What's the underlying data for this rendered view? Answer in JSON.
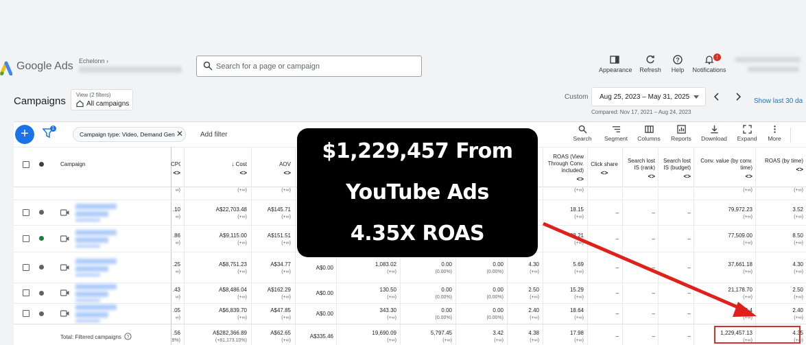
{
  "header": {
    "app_name": "Google Ads",
    "account_label": "Echelonn",
    "search_placeholder": "Search for a page or campaign",
    "tools": [
      {
        "label": "Appearance",
        "icon": "appearance-icon"
      },
      {
        "label": "Refresh",
        "icon": "refresh-icon"
      },
      {
        "label": "Help",
        "icon": "help-icon"
      },
      {
        "label": "Notifications",
        "icon": "bell-icon",
        "badge": "!"
      }
    ]
  },
  "subheader": {
    "title": "Campaigns",
    "view_line1": "View (2 filters)",
    "view_line2": "All campaigns",
    "custom_label": "Custom",
    "date_range": "Aug 25, 2023 – May 31, 2025",
    "compared": "Compared: Nov 17, 2021 – Aug 24, 2023",
    "show_last": "Show last 30 da"
  },
  "filterbar": {
    "filter_count": "1",
    "chip_label": "Campaign type: Video, Demand Gen",
    "add_filter": "Add filter",
    "tools": [
      "Search",
      "Segment",
      "Columns",
      "Reports",
      "Download",
      "Expand",
      "More"
    ]
  },
  "table": {
    "headers": {
      "campaign": "Campaign",
      "cpc": "CPC",
      "cost": "Cost",
      "aov": "AOV",
      "roas_vt": "ROAS (View Through Conv. included)",
      "click_share": "Click share",
      "lost_rank": "Search lost IS (rank)",
      "lost_budget": "Search lost IS (budget)",
      "conv_value": "Conv. value (by conv. time)",
      "roas": "ROAS (by time)"
    },
    "rows": [
      {
        "status": "grey",
        "cpc": "",
        "cpc_sub": "∞)",
        "cost": "",
        "cost_sub": "(+∞)",
        "aov": "",
        "aov_sub": "(+∞)",
        "c5": "",
        "c5s": "",
        "c6": "",
        "c6s": "",
        "c7": "",
        "c7s": "",
        "c8": "",
        "c8s": "",
        "roas_vt": "",
        "roas_vt_sub": "(+∞)",
        "click_share": "",
        "lost_rank": "",
        "lost_budget": "",
        "conv_value": "",
        "conv_value_sub": "(+∞)",
        "roas": "",
        "roas_sub": "(+∞)"
      },
      {
        "status": "grey",
        "cpc": ".10",
        "cpc_sub": "∞)",
        "cost": "A$22,703.48",
        "cost_sub": "(+∞)",
        "aov": "A$145.71",
        "aov_sub": "(+∞)",
        "c5": "",
        "c5s": "",
        "c6": "",
        "c6s": "",
        "c7": "",
        "c7s": "",
        "c8": "",
        "c8s": "",
        "roas_vt": "18.15",
        "roas_vt_sub": "(+∞)",
        "click_share": "–",
        "lost_rank": "–",
        "lost_budget": "–",
        "conv_value": "79,972.23",
        "conv_value_sub": "(+∞)",
        "roas": "3.52",
        "roas_sub": "(+∞)"
      },
      {
        "status": "green",
        "cpc": ".86",
        "cpc_sub": "∞)",
        "cost": "A$9,115.00",
        "cost_sub": "(+∞)",
        "aov": "A$151.51",
        "aov_sub": "(+∞)",
        "c5": "",
        "c5s": "",
        "c6": "",
        "c6s": "",
        "c7": "",
        "c7s": "",
        "c8": "",
        "c8s": "",
        "roas_vt": "28.21",
        "roas_vt_sub": "(+∞)",
        "click_share": "–",
        "lost_rank": "–",
        "lost_budget": "–",
        "conv_value": "77,509.00",
        "conv_value_sub": "(+∞)",
        "roas": "8.50",
        "roas_sub": "(+∞)"
      },
      {
        "status": "grey",
        "cpc": ".25",
        "cpc_sub": "∞)",
        "cost": "A$8,751.23",
        "cost_sub": "(+∞)",
        "aov": "A$34.77",
        "aov_sub": "(+∞)",
        "c5": "A$0.00",
        "c5s": "",
        "c6": "1,083.02",
        "c6s": "(+∞)",
        "c7": "0.00",
        "c7s": "(0.00%)",
        "c8": "0.00",
        "c8s": "(0.00%)",
        "c9": "4.30",
        "c9s": "(+∞)",
        "roas_vt": "5.69",
        "roas_vt_sub": "(+∞)",
        "click_share": "–",
        "lost_rank": "–",
        "lost_budget": "–",
        "conv_value": "37,661.18",
        "conv_value_sub": "(+∞)",
        "roas": "4.30",
        "roas_sub": "(+∞)"
      },
      {
        "status": "grey",
        "cpc": ".43",
        "cpc_sub": "∞)",
        "cost": "A$8,486.04",
        "cost_sub": "(+∞)",
        "aov": "A$162.29",
        "aov_sub": "(+∞)",
        "c5": "A$0.00",
        "c5s": "",
        "c6": "130.50",
        "c6s": "(+∞)",
        "c7": "0.00",
        "c7s": "(0.00%)",
        "c8": "0.00",
        "c8s": "(0.00%)",
        "c9": "2.50",
        "c9s": "(+∞)",
        "roas_vt": "15.29",
        "roas_vt_sub": "(+∞)",
        "click_share": "–",
        "lost_rank": "–",
        "lost_budget": "–",
        "conv_value": "21,178.70",
        "conv_value_sub": "(+∞)",
        "roas": "2.50",
        "roas_sub": "(+∞)"
      },
      {
        "status": "grey",
        "cpc": ".05",
        "cpc_sub": "∞)",
        "cost": "A$6,839.70",
        "cost_sub": "(+∞)",
        "aov": "A$47.85",
        "aov_sub": "(+∞)",
        "c5": "A$0.00",
        "c5s": "",
        "c6": "343.30",
        "c6s": "(+∞)",
        "c7": "0.00",
        "c7s": "(0.00%)",
        "c8": "0.00",
        "c8s": "(0.00%)",
        "c9": "2.40",
        "c9s": "(+∞)",
        "roas_vt": "18.64",
        "roas_vt_sub": "(+∞)",
        "click_share": "–",
        "lost_rank": "–",
        "lost_budget": "–",
        "conv_value": "16,4",
        "conv_value_sub": "(+∞)",
        "roas": "2.40",
        "roas_sub": "(+∞)"
      }
    ],
    "total": {
      "label": "Total: Filtered campaigns",
      "cpc": ".56",
      "cpc_sub": "9%)",
      "cost": "A$282,366.89",
      "cost_sub": "(+81,173.10%)",
      "aov": "A$62.65",
      "aov_sub": "(+∞)",
      "c5": "A$335.46",
      "c6": "19,690.09",
      "c6s": "(+∞)",
      "c7": "5,797.45",
      "c7s": "(+∞)",
      "c8": "3.42",
      "c8s": "(+∞)",
      "c9": "4.38",
      "c9s": "(+∞)",
      "roas_vt": "17.98",
      "roas_vt_sub": "(+∞)",
      "click_share": "–",
      "lost_rank": "–",
      "lost_budget": "–",
      "conv_value": "1,229,457.13",
      "conv_value_sub": "(+∞)",
      "roas": "4.35",
      "roas_sub": "(+∞)"
    }
  },
  "overlay": {
    "line1": "$1,229,457 From",
    "line2": "YouTube Ads",
    "line3": "4.35X ROAS"
  },
  "colors": {
    "brand_blue": "#1a73e8",
    "highlight_red": "#d93025",
    "overlay_bg": "#000000"
  }
}
